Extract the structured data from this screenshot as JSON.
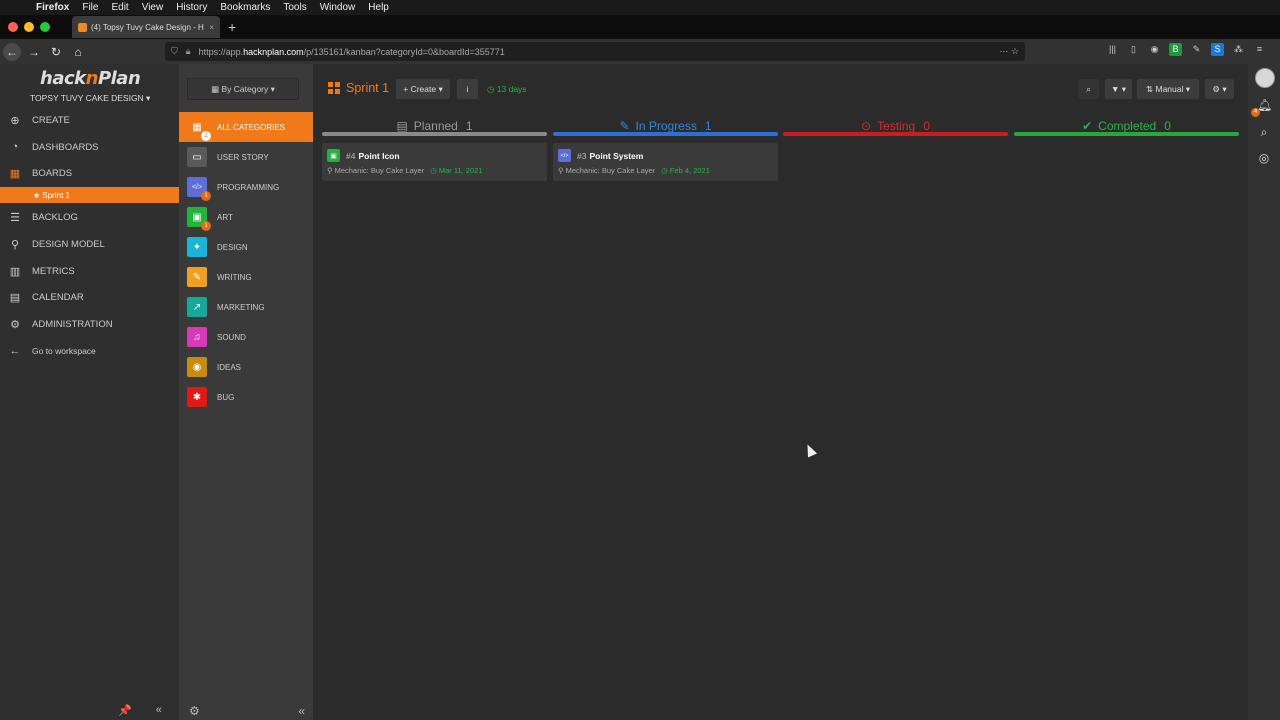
{
  "menubar": {
    "apple": "",
    "items": [
      "Firefox",
      "File",
      "Edit",
      "View",
      "History",
      "Bookmarks",
      "Tools",
      "Window",
      "Help"
    ]
  },
  "browser": {
    "tab_title": "(4) Topsy Tuvy Cake Design - H",
    "tab_close": "×",
    "new_tab": "+",
    "url_prefix": "https://app.",
    "url_host": "hacknplan.com",
    "url_path": "/p/135161/kanban?categoryId=0&boardId=355771",
    "url_actions": "··· ☆"
  },
  "sidebar": {
    "logo_a": "hack",
    "logo_n": "n",
    "logo_b": "Plan",
    "project": "TOPSY TUVY CAKE DESIGN ▾",
    "items": [
      {
        "label": "CREATE",
        "icon": "plus-circle-icon",
        "glyph": "⊕"
      },
      {
        "label": "DASHBOARDS",
        "icon": "dashboard-icon",
        "glyph": "◔"
      },
      {
        "label": "BOARDS",
        "icon": "boards-icon",
        "glyph": "▦"
      },
      {
        "label": "BACKLOG",
        "icon": "backlog-icon",
        "glyph": "☰"
      },
      {
        "label": "DESIGN MODEL",
        "icon": "design-model-icon",
        "glyph": "⚲"
      },
      {
        "label": "METRICS",
        "icon": "metrics-icon",
        "glyph": "▥"
      },
      {
        "label": "CALENDAR",
        "icon": "calendar-icon",
        "glyph": "▤"
      },
      {
        "label": "ADMINISTRATION",
        "icon": "gear-icon",
        "glyph": "⚙"
      },
      {
        "label": "Go to workspace",
        "icon": "arrow-left-icon",
        "glyph": "←"
      }
    ],
    "sub_item": "★ Sprint 1",
    "pin": "📌",
    "collapse": "«"
  },
  "categories": {
    "select_label": "▦ By Category ▾",
    "items": [
      {
        "label": "ALL CATEGORIES",
        "color": "#f07a1a",
        "glyph": "▦",
        "badge": "2",
        "icon": "all-categories-icon"
      },
      {
        "label": "USER STORY",
        "color": "#5a5a5a",
        "glyph": "▭",
        "badge": "",
        "icon": "user-story-icon"
      },
      {
        "label": "PROGRAMMING",
        "color": "#5b6fd6",
        "glyph": "</>",
        "badge": "1",
        "icon": "programming-icon"
      },
      {
        "label": "ART",
        "color": "#22b33a",
        "glyph": "▣",
        "badge": "1",
        "icon": "art-icon"
      },
      {
        "label": "DESIGN",
        "color": "#1ab5d6",
        "glyph": "✦",
        "badge": "",
        "icon": "design-icon"
      },
      {
        "label": "WRITING",
        "color": "#f0a020",
        "glyph": "✎",
        "badge": "",
        "icon": "writing-icon"
      },
      {
        "label": "MARKETING",
        "color": "#17a89a",
        "glyph": "↗",
        "badge": "",
        "icon": "marketing-icon"
      },
      {
        "label": "SOUND",
        "color": "#d63ab8",
        "glyph": "♫",
        "badge": "",
        "icon": "sound-icon"
      },
      {
        "label": "IDEAS",
        "color": "#c98a10",
        "glyph": "◉",
        "badge": "",
        "icon": "ideas-icon"
      },
      {
        "label": "BUG",
        "color": "#e01818",
        "glyph": "✱",
        "badge": "",
        "icon": "bug-icon"
      }
    ],
    "settings": "⚙",
    "collapse": "«"
  },
  "board": {
    "sprint_title": "Sprint 1",
    "create_label": "+ Create ▾",
    "info_label": "i",
    "days": "◷ 13 days",
    "search": "⌕",
    "filter": "▼ ▾",
    "manual": "⇅ Manual ▾",
    "settings": "⚙ ▾",
    "columns": [
      {
        "label": "Planned",
        "count": "1",
        "color": "#9a9a9a",
        "line": "#8a8a8a",
        "glyph": "▤",
        "icon": "calendar-icon"
      },
      {
        "label": "In Progress",
        "count": "1",
        "color": "#2e8ae0",
        "line": "#2e6fd6",
        "glyph": "✎",
        "icon": "wrench-icon"
      },
      {
        "label": "Testing",
        "count": "0",
        "color": "#d62a2a",
        "line": "#c81e1e",
        "glyph": "⊙",
        "icon": "gamepad-icon"
      },
      {
        "label": "Completed",
        "count": "0",
        "color": "#2bb24c",
        "line": "#28a83a",
        "glyph": "✔",
        "icon": "check-icon"
      }
    ],
    "cards": [
      {
        "num": "#4",
        "name": "Point Icon",
        "meta": "⚲ Mechanic: Buy Cake Layer",
        "date": "◷ Mar 11, 2021",
        "color": "#22b33a",
        "glyph": "▣"
      },
      {
        "num": "#3",
        "name": "Point System",
        "meta": "⚲ Mechanic: Buy Cake Layer",
        "date": "◷ Feb 4, 2021",
        "color": "#5b6fd6",
        "glyph": "</>"
      }
    ]
  },
  "rail": {
    "notif_count": "4"
  }
}
